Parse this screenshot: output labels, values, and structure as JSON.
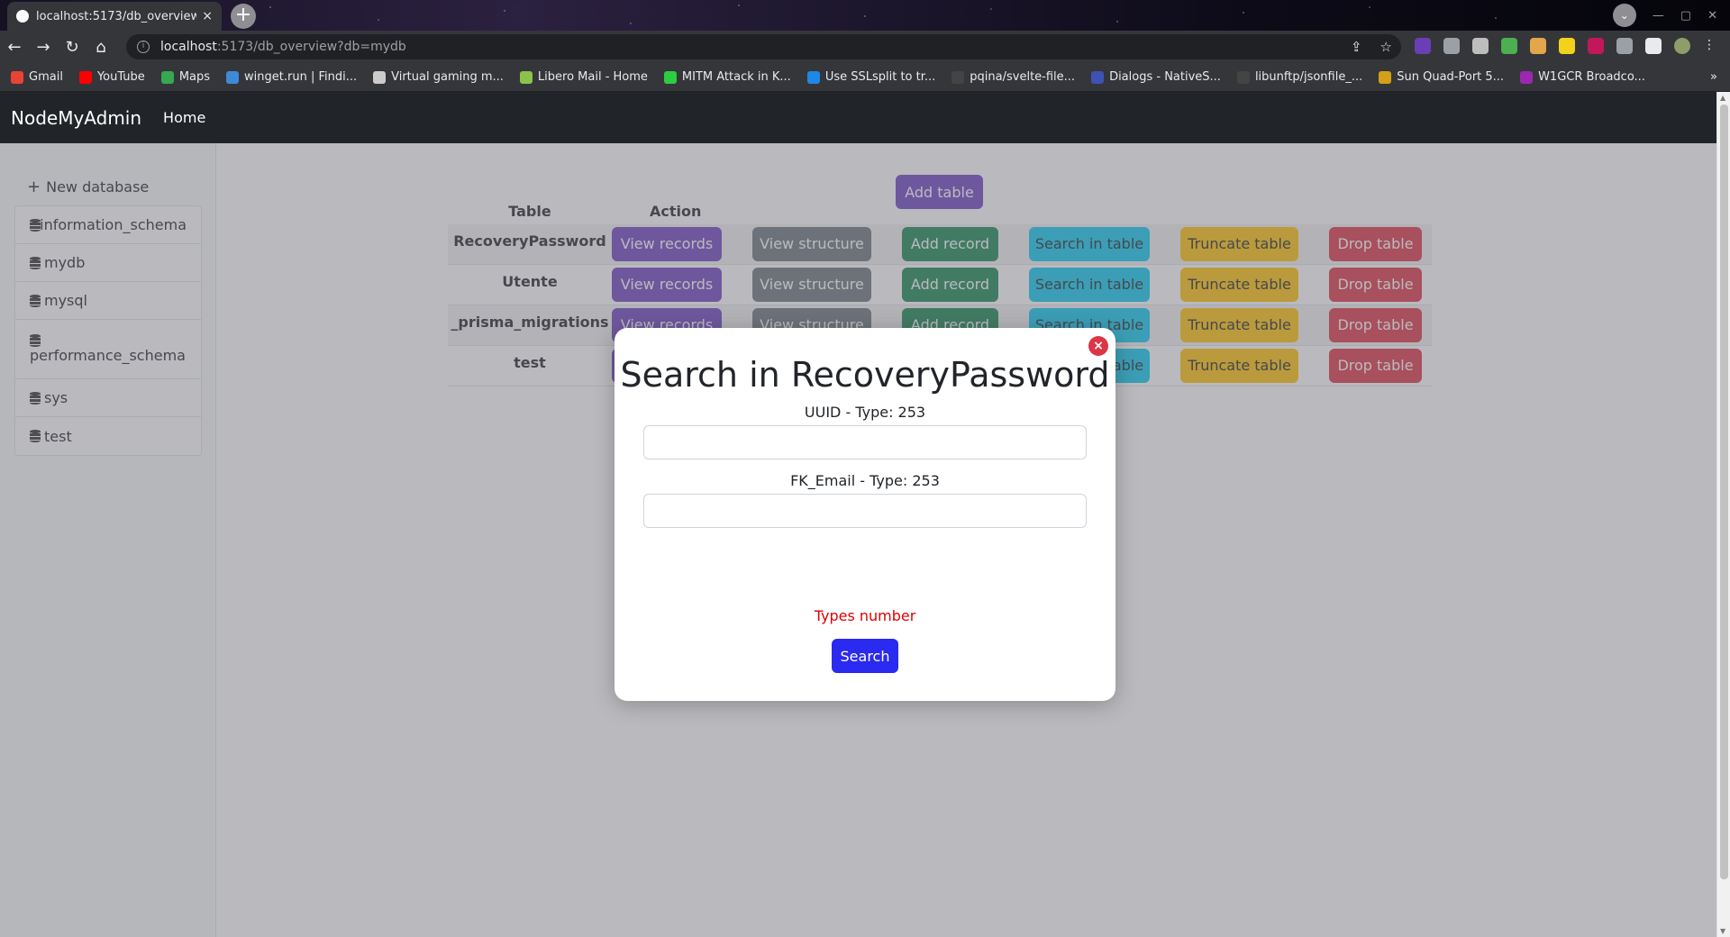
{
  "browser": {
    "tab_title": "localhost:5173/db_overview",
    "tab_close": "×",
    "new_tab": "+",
    "url_host": "localhost",
    "url_path": ":5173/db_overview?db=mydb",
    "bookmarks": [
      {
        "label": "Gmail",
        "color": "#ea4335"
      },
      {
        "label": "YouTube",
        "color": "#ff0000"
      },
      {
        "label": "Maps",
        "color": "#34a853"
      },
      {
        "label": "winget.run | Findi...",
        "color": "#3d8bd6"
      },
      {
        "label": "Virtual gaming m...",
        "color": "#cccccc"
      },
      {
        "label": "Libero Mail - Home",
        "color": "#8bc34a"
      },
      {
        "label": "MITM Attack in K...",
        "color": "#2ecc40"
      },
      {
        "label": "Use SSLsplit to tr...",
        "color": "#1e88e5"
      },
      {
        "label": "pqina/svelte-file...",
        "color": "#444444"
      },
      {
        "label": "Dialogs - NativeS...",
        "color": "#3f51b5"
      },
      {
        "label": "libunftp/jsonfile_...",
        "color": "#444444"
      },
      {
        "label": "Sun Quad-Port 5...",
        "color": "#d4a017"
      },
      {
        "label": "W1GCR Broadco...",
        "color": "#9c27b0"
      }
    ],
    "bookmarks_more": "»"
  },
  "app": {
    "brand": "NodeMyAdmin",
    "nav_home": "Home",
    "new_database": "New database",
    "databases": [
      "information_schema",
      "mydb",
      "mysql",
      "performance_schema",
      "sys",
      "test"
    ],
    "add_table": "Add table",
    "table_header": "Table",
    "action_header": "Action",
    "tables": [
      "RecoveryPassword",
      "Utente",
      "_prisma_migrations",
      "test"
    ],
    "actions": {
      "view_records": "View records",
      "view_structure": "View structure",
      "add_record": "Add record",
      "search_in_table": "Search in table",
      "truncate_table": "Truncate table",
      "drop_table": "Drop table"
    }
  },
  "modal": {
    "title": "Search in RecoveryPassword",
    "close": "×",
    "fields": [
      {
        "label": "UUID - Type: 253",
        "value": ""
      },
      {
        "label": "FK_Email - Type: 253",
        "value": ""
      }
    ],
    "types_note": "Types number",
    "search_button": "Search"
  },
  "colors": {
    "navbar": "#212529",
    "primary_purple": "#6f42c1",
    "secondary": "#6c757d",
    "success": "#198754",
    "info": "#0dcaf0",
    "warning": "#ffc107",
    "danger": "#dc3545",
    "search_button": "#2a2af0"
  }
}
